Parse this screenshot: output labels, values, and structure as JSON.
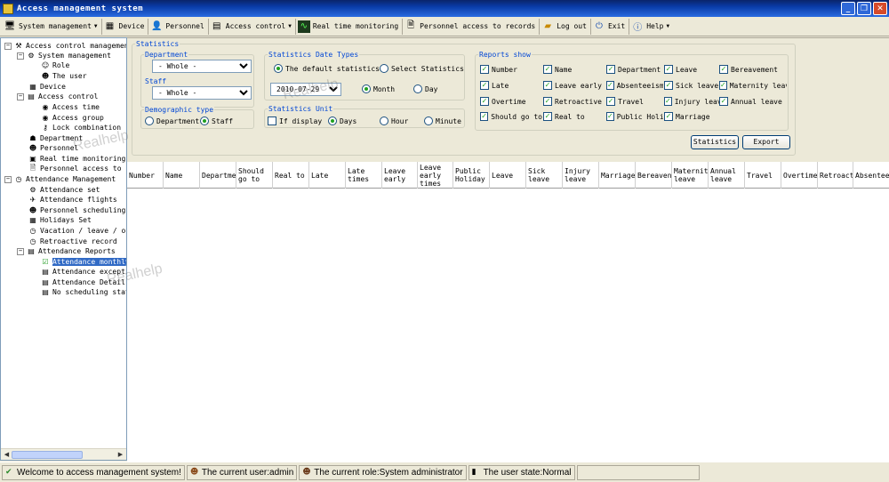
{
  "window": {
    "title": "Access management system"
  },
  "toolbar": {
    "items": [
      {
        "label": "System management",
        "icon": "system-icon",
        "dropdown": true
      },
      {
        "label": "Device",
        "icon": "device-icon",
        "dropdown": false
      },
      {
        "label": "Personnel",
        "icon": "personnel-icon",
        "dropdown": false
      },
      {
        "label": "Access control",
        "icon": "access-control-icon",
        "dropdown": true
      },
      {
        "label": "Real time monitoring",
        "icon": "monitor-icon",
        "dropdown": false
      },
      {
        "label": "Personnel access to records",
        "icon": "records-icon",
        "dropdown": false
      },
      {
        "label": "Log out",
        "icon": "logout-icon",
        "dropdown": false
      },
      {
        "label": "Exit",
        "icon": "exit-icon",
        "dropdown": false
      },
      {
        "label": "Help",
        "icon": "help-icon",
        "dropdown": true
      }
    ]
  },
  "tree": {
    "items": [
      {
        "label": "Access control management",
        "level": 0,
        "expander": "-"
      },
      {
        "label": "System management",
        "level": 1,
        "expander": "-"
      },
      {
        "label": "Role",
        "level": 2
      },
      {
        "label": "The user",
        "level": 2
      },
      {
        "label": "Device",
        "level": 1
      },
      {
        "label": "Access control",
        "level": 1,
        "expander": "-"
      },
      {
        "label": "Access time",
        "level": 2
      },
      {
        "label": "Access group",
        "level": 2
      },
      {
        "label": "Lock combination",
        "level": 2
      },
      {
        "label": "Department",
        "level": 1
      },
      {
        "label": "Personnel",
        "level": 1
      },
      {
        "label": "Real time monitoring",
        "level": 1
      },
      {
        "label": "Personnel access to re",
        "level": 1
      },
      {
        "label": "Attendance Management",
        "level": 0,
        "expander": "-"
      },
      {
        "label": "Attendance set",
        "level": 1
      },
      {
        "label": "Attendance flights",
        "level": 1
      },
      {
        "label": "Personnel scheduling",
        "level": 1
      },
      {
        "label": "Holidays Set",
        "level": 1
      },
      {
        "label": "Vacation / leave / ove",
        "level": 1
      },
      {
        "label": "Retroactive record",
        "level": 1
      },
      {
        "label": "Attendance Reports",
        "level": 1,
        "expander": "-"
      },
      {
        "label": "Attendance monthly",
        "level": 2,
        "selected": true
      },
      {
        "label": "Attendance excepti",
        "level": 2
      },
      {
        "label": "Attendance Detail",
        "level": 2
      },
      {
        "label": "No scheduling stat",
        "level": 2
      }
    ]
  },
  "statistics": {
    "group_title": "Statistics",
    "department": {
      "label": "Department",
      "value": "- Whole -"
    },
    "staff": {
      "label": "Staff",
      "value": "- Whole -"
    },
    "demographic": {
      "label": "Demographic type",
      "options": [
        "Department",
        "Staff"
      ],
      "selected": "Staff"
    },
    "date_types": {
      "label": "Statistics Date Types",
      "options": [
        "The default statistics",
        "Select Statistics"
      ],
      "selected": "The default statistics",
      "date": "2010-07-29",
      "period_options": [
        "Month",
        "Day"
      ],
      "period_selected": "Month"
    },
    "unit": {
      "label": "Statistics Unit",
      "if_display": "If display",
      "options": [
        "Days",
        "Hour",
        "Minute"
      ],
      "selected": "Days"
    },
    "reports_show": {
      "label": "Reports show",
      "items": [
        "Number",
        "Name",
        "Department",
        "Leave",
        "Bereavement",
        "Late",
        "Leave early",
        "Absenteeism",
        "Sick leave",
        "Maternity leave",
        "Overtime",
        "Retroactive",
        "Travel",
        "Injury leave",
        "Annual leave",
        "Should go to",
        "Real to",
        "Public Holiday",
        "Marriage"
      ]
    },
    "buttons": {
      "statistics": "Statistics",
      "export": "Export"
    }
  },
  "table": {
    "columns": [
      "Number",
      "Name",
      "Departme",
      "Should go to",
      "Real to",
      "Late",
      "Late times",
      "Leave early",
      "Leave early times",
      "Public Holiday",
      "Leave",
      "Sick leave",
      "Injury leave",
      "Marriage",
      "Bereaven",
      "Maternit leave",
      "Annual leave",
      "Travel",
      "Overtime",
      "Retroact",
      "Absentee"
    ]
  },
  "status": {
    "welcome": "Welcome to access management system!",
    "user": "The current user:admin",
    "role": "The current role:System administrator",
    "state": "The user state:Normal"
  },
  "watermark": "Realhelp"
}
